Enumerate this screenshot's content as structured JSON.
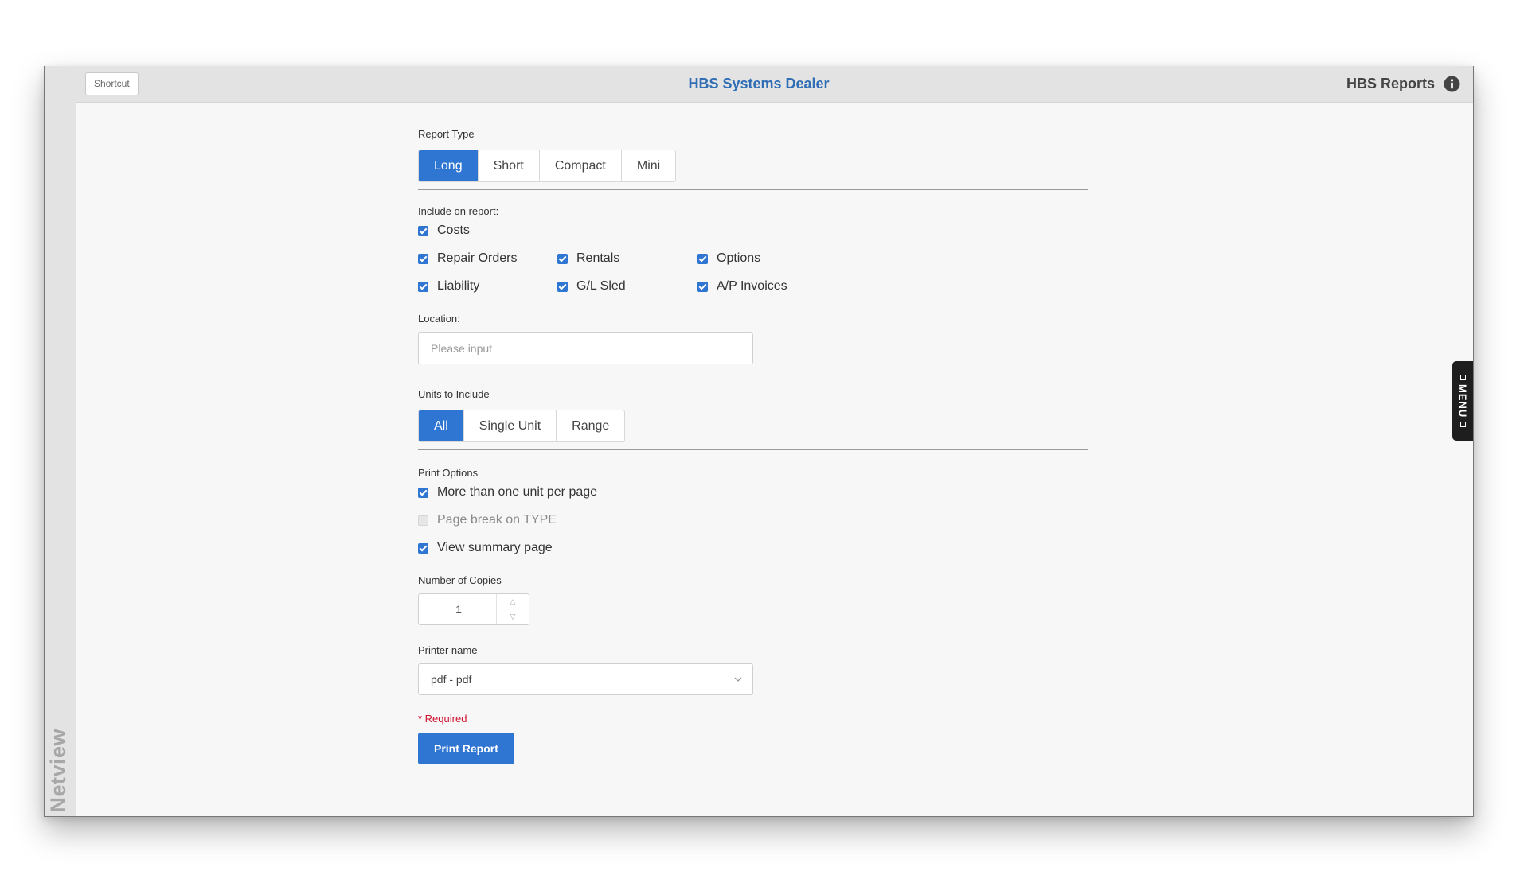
{
  "header": {
    "shortcut_label": "Shortcut",
    "app_title": "HBS Systems Dealer",
    "reports_title": "HBS Reports",
    "info_icon": "info-circle-icon"
  },
  "sidebar": {
    "brand": "Netview"
  },
  "menu_tab": {
    "label": "MENU"
  },
  "report_type": {
    "label": "Report Type",
    "options": [
      "Long",
      "Short",
      "Compact",
      "Mini"
    ],
    "selected": "Long"
  },
  "include": {
    "label": "Include on report:",
    "costs": "Costs",
    "repair_orders": "Repair Orders",
    "rentals": "Rentals",
    "options": "Options",
    "liability": "Liability",
    "gl_sled": "G/L Sled",
    "ap_invoices": "A/P Invoices"
  },
  "location": {
    "label": "Location:",
    "placeholder": "Please input",
    "value": ""
  },
  "units": {
    "label": "Units to Include",
    "options": [
      "All",
      "Single Unit",
      "Range"
    ],
    "selected": "All"
  },
  "print_options": {
    "label": "Print Options",
    "more_than_one": "More than one unit per page",
    "page_break": "Page break on TYPE",
    "view_summary": "View summary page"
  },
  "copies": {
    "label": "Number of Copies",
    "value": "1"
  },
  "printer": {
    "label": "Printer name",
    "value": "pdf - pdf"
  },
  "form": {
    "required_note": "* Required",
    "submit_label": "Print Report"
  },
  "colors": {
    "accent": "#2f76d2",
    "title": "#2f6db5",
    "required": "#d0102e"
  }
}
